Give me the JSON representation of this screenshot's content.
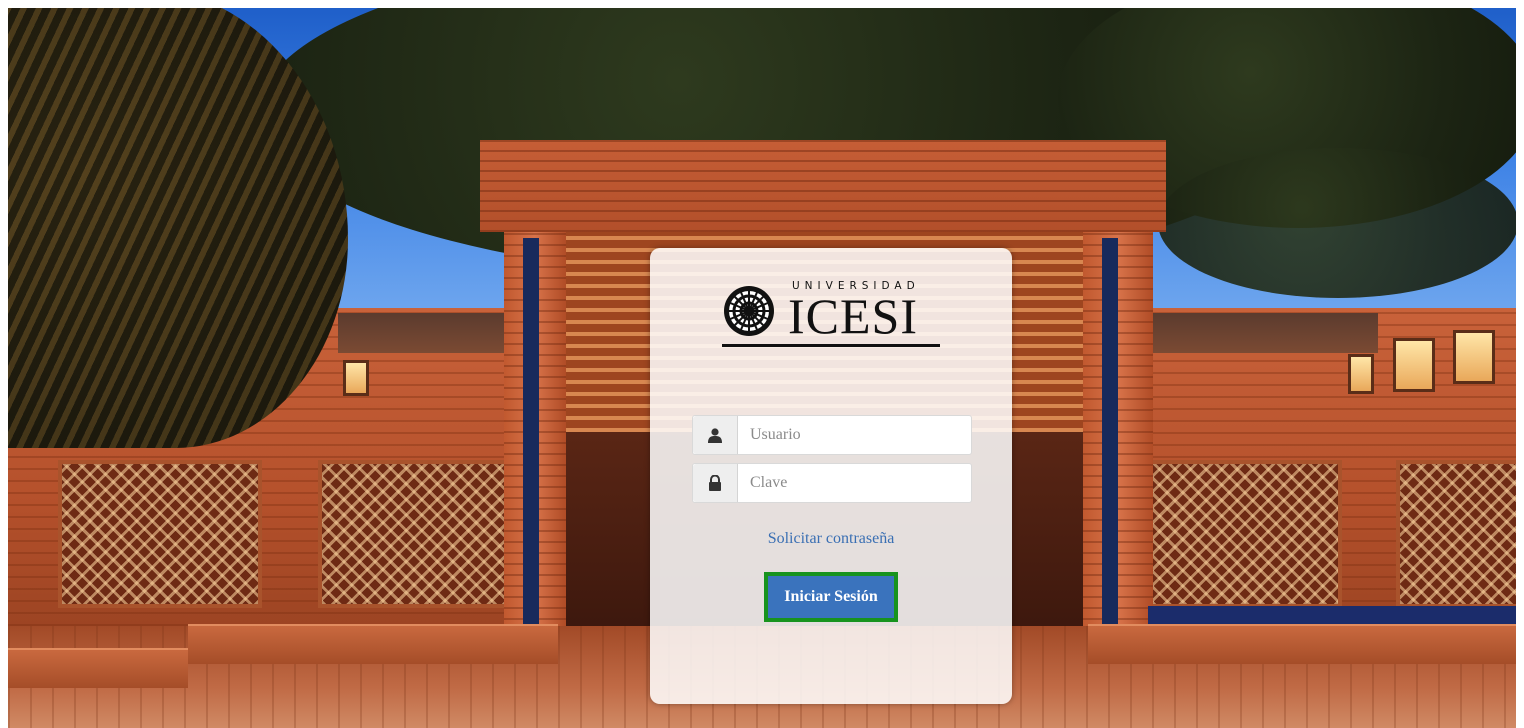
{
  "logo": {
    "university_label": "UNIVERSIDAD",
    "name": "ICESI"
  },
  "login": {
    "username_placeholder": "Usuario",
    "password_placeholder": "Clave",
    "forgot_password_link": "Solicitar contraseña",
    "submit_label": "Iniciar Sesión"
  },
  "icons": {
    "username": "user-icon",
    "password": "lock-icon",
    "seal": "icesi-seal-icon"
  },
  "colors": {
    "link": "#3a6fb3",
    "button": "#3a73bd",
    "button_highlight_border": "#17931e"
  }
}
